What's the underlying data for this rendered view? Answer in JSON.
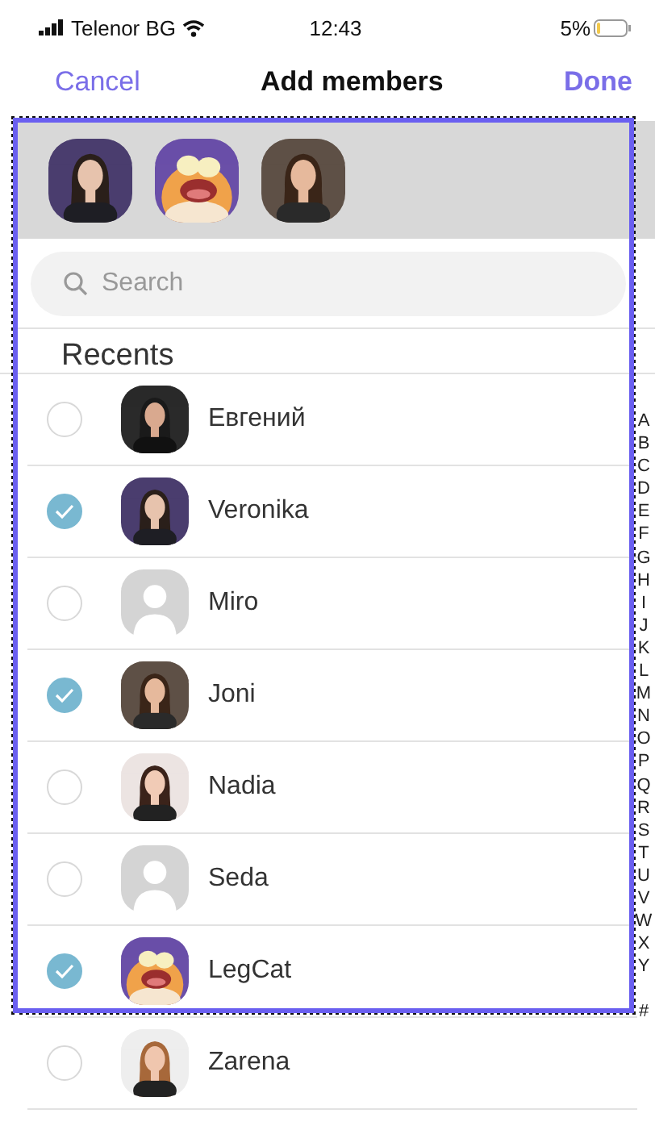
{
  "status_bar": {
    "carrier": "Telenor BG",
    "time": "12:43",
    "battery": "5%"
  },
  "nav": {
    "cancel": "Cancel",
    "title": "Add members",
    "done": "Done"
  },
  "search": {
    "placeholder": "Search"
  },
  "section_title": "Recents",
  "contacts": [
    {
      "name": "Евгений",
      "selected": false,
      "kind": "picture"
    },
    {
      "name": "Veronika",
      "selected": true,
      "kind": "picture"
    },
    {
      "name": "Miro",
      "selected": false,
      "kind": "placeholder"
    },
    {
      "name": "Joni",
      "selected": true,
      "kind": "picture"
    },
    {
      "name": "Nadia",
      "selected": false,
      "kind": "picture"
    },
    {
      "name": "Seda",
      "selected": false,
      "kind": "placeholder"
    },
    {
      "name": "LegCat",
      "selected": true,
      "kind": "picture"
    },
    {
      "name": "Zarena",
      "selected": false,
      "kind": "picture"
    }
  ],
  "index_letters": [
    "A",
    "B",
    "C",
    "D",
    "E",
    "F",
    "G",
    "H",
    "I",
    "J",
    "K",
    "L",
    "M",
    "N",
    "O",
    "P",
    "Q",
    "R",
    "S",
    "T",
    "U",
    "V",
    "W",
    "X",
    "Y",
    "#"
  ],
  "highlight_frame": true
}
